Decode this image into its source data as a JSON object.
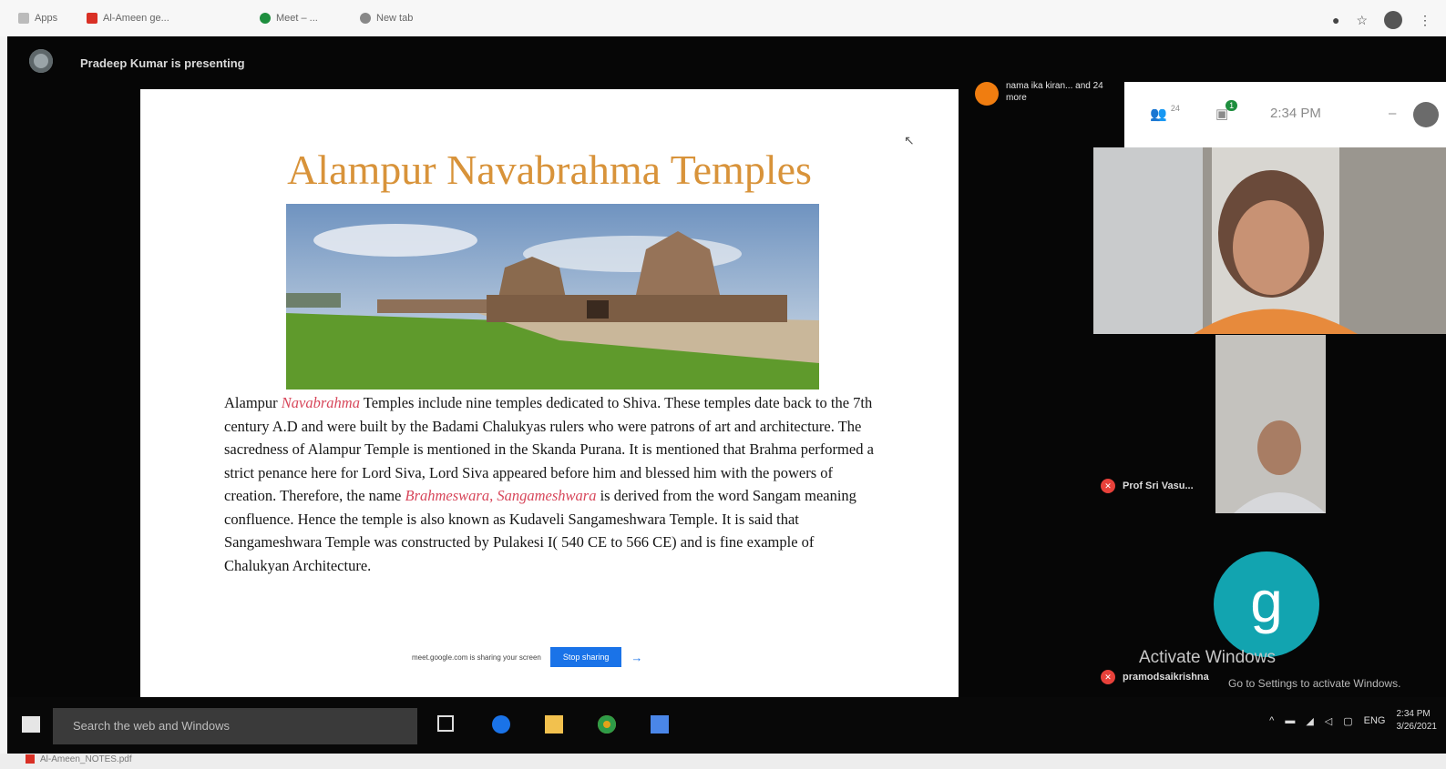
{
  "browser": {
    "bookmarks": [
      {
        "label": "Apps",
        "icon": "apps-icon"
      },
      {
        "label": "Al-Ameen ge...",
        "icon": "bookmark-red-icon"
      },
      {
        "label": "Meet – ...",
        "icon": "bookmark-green-icon"
      },
      {
        "label": "New tab",
        "icon": "globe-icon"
      }
    ]
  },
  "meeting": {
    "presenter_text": "Pradeep Kumar is presenting",
    "participant_chip": "nama ika kiran... and 24 more",
    "controls": {
      "participants_count": "24",
      "chat_badge": "1",
      "time": "2:34 PM"
    },
    "participants": [
      {
        "name": "Prof Sri Vasu..."
      },
      {
        "name": "pramodsaikrishna"
      }
    ],
    "g_avatar_letter": "g",
    "activate_windows": "Activate Windows",
    "activate_windows_sub": "Go to Settings to activate Windows."
  },
  "slide": {
    "title": "Alampur Navabrahma Temples",
    "paragraph_1_a": "Alampur ",
    "paragraph_1_hl": "Navabrahma",
    "paragraph_1_b": " Temples include nine temples dedicated to Shiva.  These temples date back to the 7th century A.D and were built by the Badami Chalukyas rulers who were patrons of art and architecture. The sacredness of Alampur Temple is mentioned in the Skanda Purana. It is mentioned that Brahma performed a strict penance here for Lord Siva, Lord Siva appeared before him and blessed him with the powers of creation. Therefore, the name ",
    "paragraph_2_hl": "Brahmeswara, Sangameshwara",
    "paragraph_2_b": " is derived from the word Sangam meaning confluence. Hence the temple is also known as Kudaveli Sangameshwara Temple. It is said that Sangameshwara Temple was constructed by Pulakesi I( 540 CE to 566 CE) and is fine example of Chalukyan Architecture.",
    "notice_text": "meet.google.com is sharing your screen",
    "notice_button": "Stop sharing"
  },
  "taskbar": {
    "search_placeholder": "Search the web and Windows",
    "tray_lang": "ENG",
    "clock_time": "2:34 PM",
    "clock_date": "3/26/2021"
  },
  "bottom": {
    "item": "Al-Ameen_NOTES.pdf"
  },
  "colors": {
    "title": "#d8933a",
    "highlight": "#d7465a",
    "avatar_teal": "#12a4b0",
    "mic_off": "#e8413a",
    "chip_orange": "#f07d10",
    "stop_sharing": "#1a73e8"
  }
}
